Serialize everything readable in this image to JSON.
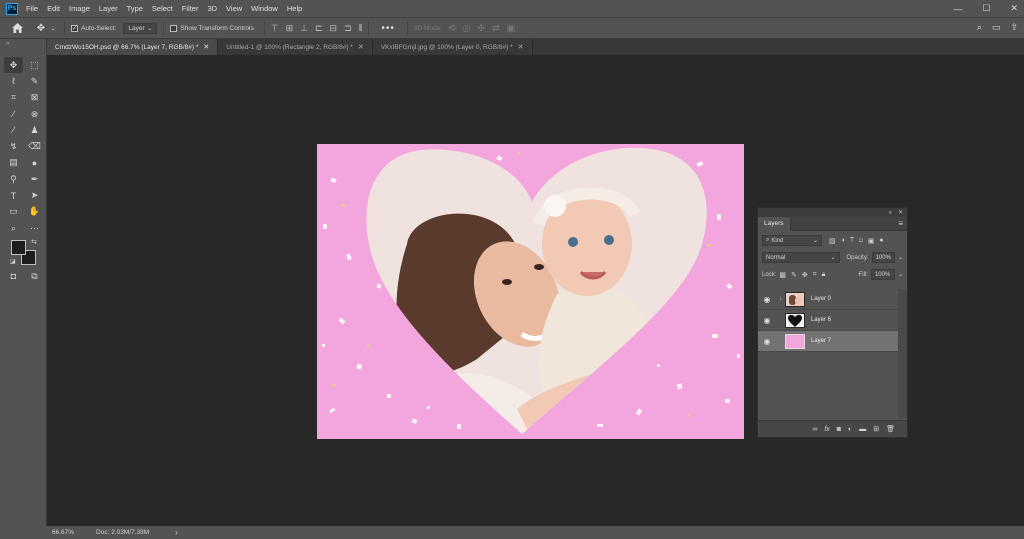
{
  "app": {
    "logo": "Ps"
  },
  "menu": [
    "File",
    "Edit",
    "Image",
    "Layer",
    "Type",
    "Select",
    "Filter",
    "3D",
    "View",
    "Window",
    "Help"
  ],
  "window_controls": {
    "minimize": "—",
    "maximize": "☐",
    "close": "✕"
  },
  "options_bar": {
    "home_icon": "home-icon",
    "move_tool_icon": "move-icon",
    "auto_select_label": "Auto-Select:",
    "auto_select_checked": true,
    "auto_select_target": "Layer",
    "show_transform_label": "Show Transform Controls",
    "show_transform_checked": false,
    "more_label": "•••",
    "mode_3d_label": "3D Mode:"
  },
  "tabs": [
    {
      "label": "CmdzWo15OH.psd @ 66.7% (Layer 7, RGB/8#) *",
      "close": "✕",
      "active": true
    },
    {
      "label": "Untitled-1 @ 100% (Rectangle 2, RGB/8#) *",
      "close": "✕",
      "active": false
    },
    {
      "label": "VKxIBFGmjI.jpg @ 100% (Layer 0, RGB/8#) *",
      "close": "✕",
      "active": false
    }
  ],
  "status": {
    "zoom": "66.67%",
    "doc": "Doc: 2.03M/7.38M",
    "arrow": "›"
  },
  "layers_panel": {
    "tab_label": "Layers",
    "kind_label": "Kind",
    "blend_mode": "Normal",
    "opacity_label": "Opacity:",
    "opacity_value": "100%",
    "lock_label": "Lock:",
    "fill_label": "Fill:",
    "fill_value": "100%",
    "layers": [
      {
        "name": "Layer 0",
        "visible": true,
        "clipped": true,
        "selected": false
      },
      {
        "name": "Layer 6",
        "visible": true,
        "clipped": false,
        "selected": false
      },
      {
        "name": "Layer 7",
        "visible": true,
        "clipped": false,
        "selected": true
      }
    ],
    "footer_icons": [
      "link-icon",
      "fx-icon",
      "mask-icon",
      "adjustment-icon",
      "folder-icon",
      "new-layer-icon",
      "trash-icon"
    ]
  },
  "colors": {
    "ui_panel": "#535353",
    "workspace": "#282828",
    "canvas_pink": "#f3a6de",
    "heart_fill": "#f0e3df",
    "accent_blue": "#31a8ff"
  }
}
